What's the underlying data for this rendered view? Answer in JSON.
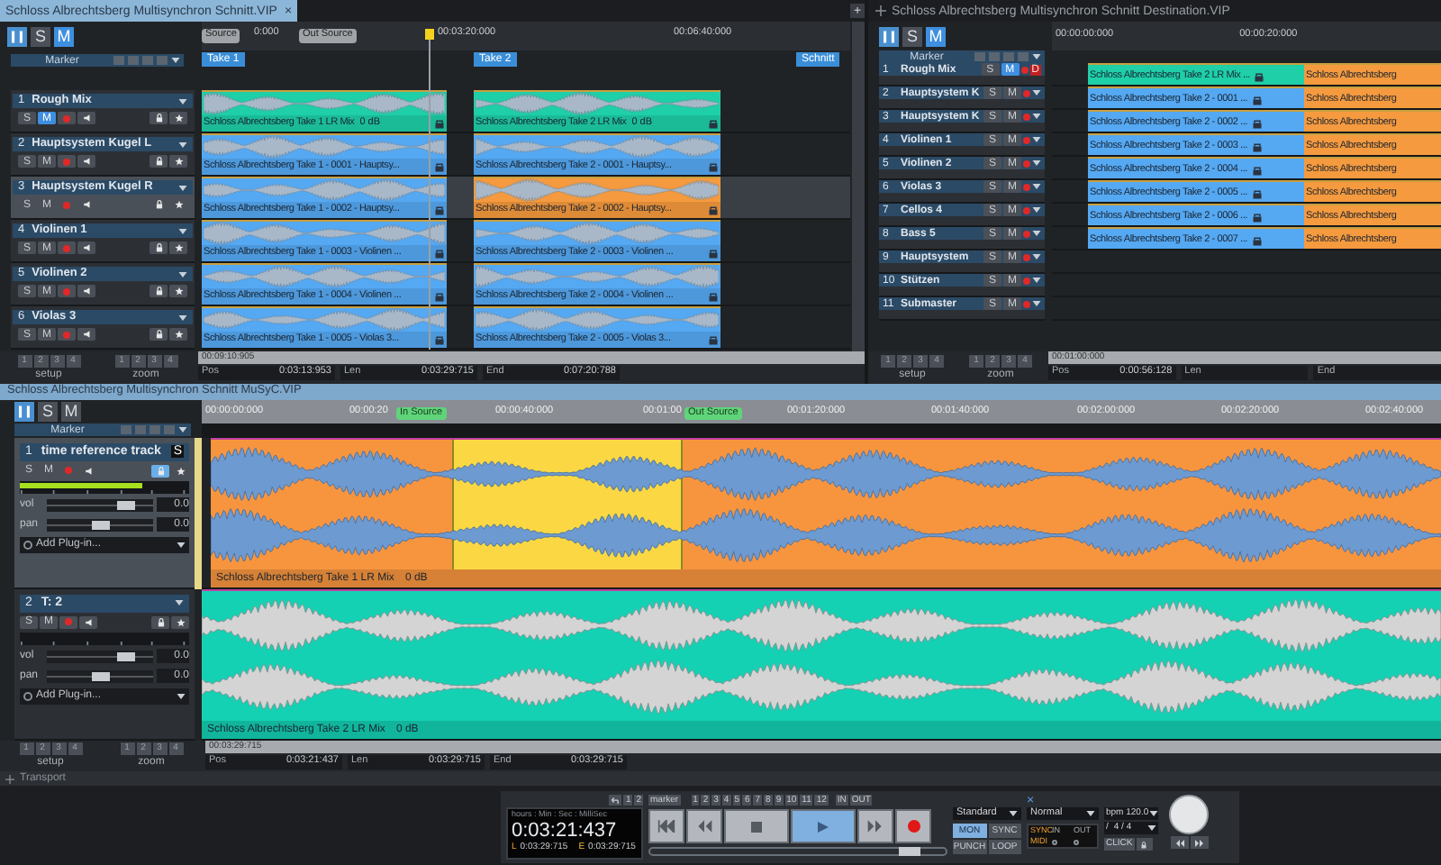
{
  "top_left": {
    "title": "Schloss Albrechtsberg Multisynchron Schnitt.VIP",
    "close": "×",
    "add_tab": "+",
    "modes": [
      {
        "label": "S",
        "selected": false
      },
      {
        "label": "M",
        "selected": true
      }
    ],
    "ruler": [
      {
        "kind": "flag",
        "label": "Source",
        "color": "#a0a4a8"
      },
      {
        "kind": "time",
        "label": "0:000"
      },
      {
        "kind": "flag",
        "label": "Out Source",
        "color": "#a0a4a8"
      },
      {
        "kind": "playhead",
        "label": "00:03:20:000"
      },
      {
        "kind": "time",
        "label": "00:06:40:000"
      }
    ],
    "ranges": [
      "Take 1",
      "Take 2",
      "Schnitt"
    ],
    "marker": "Marker",
    "tracks": [
      {
        "number": "1",
        "name": "Rough Mix",
        "selected": false,
        "solo": {
          "label": "S",
          "on": false
        },
        "mute": {
          "label": "M",
          "on": true
        },
        "clips": [
          {
            "label": "Schloss Albrechtsberg Take 1 LR Mix",
            "gain": "0 dB",
            "color": "#1ecfa8"
          },
          {
            "label": "Schloss Albrechtsberg Take 2 LR Mix",
            "gain": "0 dB",
            "color": "#1ecfa8"
          }
        ]
      },
      {
        "number": "2",
        "name": "Hauptsystem Kugel L",
        "selected": false,
        "solo": {
          "label": "S",
          "on": false
        },
        "mute": {
          "label": "M",
          "on": false
        },
        "clips": [
          {
            "label": "Schloss Albrechtsberg Take 1 - 0001 - Hauptsy...",
            "color": "#55a8f2"
          },
          {
            "label": "Schloss Albrechtsberg Take 2 - 0001 - Hauptsy...",
            "color": "#55a8f2"
          }
        ]
      },
      {
        "number": "3",
        "name": "Hauptsystem Kugel R",
        "selected": true,
        "solo": {
          "label": "S",
          "on": false
        },
        "mute": {
          "label": "M",
          "on": false
        },
        "clips": [
          {
            "label": "Schloss Albrechtsberg Take 1 - 0002 - Hauptsy...",
            "color": "#55a8f2"
          },
          {
            "label": "Schloss Albrechtsberg Take 2 - 0002 - Hauptsy...",
            "color": "#f59a3e"
          }
        ]
      },
      {
        "number": "4",
        "name": "Violinen 1",
        "selected": false,
        "solo": {
          "label": "S",
          "on": false
        },
        "mute": {
          "label": "M",
          "on": false
        },
        "clips": [
          {
            "label": "Schloss Albrechtsberg Take 1 - 0003 - Violinen ...",
            "color": "#55a8f2"
          },
          {
            "label": "Schloss Albrechtsberg Take 2 - 0003 - Violinen ...",
            "color": "#55a8f2"
          }
        ]
      },
      {
        "number": "5",
        "name": "Violinen 2",
        "selected": false,
        "solo": {
          "label": "S",
          "on": false
        },
        "mute": {
          "label": "M",
          "on": false
        },
        "clips": [
          {
            "label": "Schloss Albrechtsberg Take 1 - 0004 - Violinen ...",
            "color": "#55a8f2"
          },
          {
            "label": "Schloss Albrechtsberg Take 2 - 0004 - Violinen ...",
            "color": "#55a8f2"
          }
        ]
      },
      {
        "number": "6",
        "name": "Violas 3",
        "selected": false,
        "solo": {
          "label": "S",
          "on": false
        },
        "mute": {
          "label": "M",
          "on": false
        },
        "clips": [
          {
            "label": "Schloss Albrechtsberg Take 1 - 0005 - Violas 3...",
            "color": "#55a8f2"
          },
          {
            "label": "Schloss Albrechtsberg Take 2 - 0005 - Violas 3...",
            "color": "#55a8f2"
          }
        ]
      }
    ],
    "scroll_time": "00:09:10:905",
    "pos": [
      {
        "label": "Pos",
        "value": "0:03:13:953"
      },
      {
        "label": "Len",
        "value": "0:03:29:715"
      },
      {
        "label": "End",
        "value": "0:07:20:788"
      }
    ],
    "setup": {
      "buttons": [
        "1",
        "2",
        "3",
        "4"
      ],
      "label": "setup"
    },
    "zoom": {
      "buttons": [
        "1",
        "2",
        "3",
        "4"
      ],
      "label": "zoom"
    }
  },
  "top_right": {
    "title": "Schloss Albrechtsberg Multisynchron Schnitt Destination.VIP",
    "modes": [
      {
        "label": "S",
        "selected": false
      },
      {
        "label": "M",
        "selected": true
      }
    ],
    "ruler": [
      "00:00:00:000",
      "00:00:20:000"
    ],
    "marker": "Marker",
    "tracks": [
      {
        "number": "1",
        "name": "Rough Mix",
        "badge": "D",
        "solo": {
          "label": "S",
          "on": false
        },
        "mute": {
          "label": "M",
          "on": true
        },
        "clips": [
          {
            "label": "Schloss Albrechtsberg Take 2 LR Mix ...",
            "color": "#1ecfa8"
          },
          {
            "label": "Schloss Albrechtsberg",
            "color": "#f59a3e"
          }
        ]
      },
      {
        "number": "2",
        "name": "Hauptsystem K",
        "solo": {
          "label": "S",
          "on": false
        },
        "mute": {
          "label": "M",
          "on": false
        },
        "clips": [
          {
            "label": "Schloss Albrechtsberg Take 2 - 0001 ...",
            "color": "#55a8f2"
          },
          {
            "label": "Schloss Albrechtsberg",
            "color": "#f59a3e"
          }
        ]
      },
      {
        "number": "3",
        "name": "Hauptsystem K",
        "solo": {
          "label": "S",
          "on": false
        },
        "mute": {
          "label": "M",
          "on": false
        },
        "clips": [
          {
            "label": "Schloss Albrechtsberg Take 2 - 0002 ...",
            "color": "#55a8f2"
          },
          {
            "label": "Schloss Albrechtsberg",
            "color": "#f59a3e"
          }
        ]
      },
      {
        "number": "4",
        "name": "Violinen 1",
        "solo": {
          "label": "S",
          "on": false
        },
        "mute": {
          "label": "M",
          "on": false
        },
        "clips": [
          {
            "label": "Schloss Albrechtsberg Take 2 - 0003 ...",
            "color": "#55a8f2"
          },
          {
            "label": "Schloss Albrechtsberg",
            "color": "#f59a3e"
          }
        ]
      },
      {
        "number": "5",
        "name": "Violinen 2",
        "solo": {
          "label": "S",
          "on": false
        },
        "mute": {
          "label": "M",
          "on": false
        },
        "clips": [
          {
            "label": "Schloss Albrechtsberg Take 2 - 0004 ...",
            "color": "#55a8f2"
          },
          {
            "label": "Schloss Albrechtsberg",
            "color": "#f59a3e"
          }
        ]
      },
      {
        "number": "6",
        "name": "Violas 3",
        "solo": {
          "label": "S",
          "on": false
        },
        "mute": {
          "label": "M",
          "on": false
        },
        "clips": [
          {
            "label": "Schloss Albrechtsberg Take 2 - 0005 ...",
            "color": "#55a8f2"
          },
          {
            "label": "Schloss Albrechtsberg",
            "color": "#f59a3e"
          }
        ]
      },
      {
        "number": "7",
        "name": "Cellos 4",
        "solo": {
          "label": "S",
          "on": false
        },
        "mute": {
          "label": "M",
          "on": false
        },
        "clips": [
          {
            "label": "Schloss Albrechtsberg Take 2 - 0006 ...",
            "color": "#55a8f2"
          },
          {
            "label": "Schloss Albrechtsberg",
            "color": "#f59a3e"
          }
        ]
      },
      {
        "number": "8",
        "name": "Bass 5",
        "solo": {
          "label": "S",
          "on": false
        },
        "mute": {
          "label": "M",
          "on": false
        },
        "clips": [
          {
            "label": "Schloss Albrechtsberg Take 2 - 0007 ...",
            "color": "#55a8f2"
          },
          {
            "label": "Schloss Albrechtsberg",
            "color": "#f59a3e"
          }
        ]
      },
      {
        "number": "9",
        "name": "Hauptsystem",
        "solo": {
          "label": "S",
          "on": false
        },
        "mute": {
          "label": "M",
          "on": false
        }
      },
      {
        "number": "10",
        "name": "Stützen",
        "solo": {
          "label": "S",
          "on": false
        },
        "mute": {
          "label": "M",
          "on": false
        }
      },
      {
        "number": "11",
        "name": "Submaster",
        "solo": {
          "label": "S",
          "on": false
        },
        "mute": {
          "label": "M",
          "on": false
        }
      }
    ],
    "scroll_time": "00:01:00:000",
    "pos": [
      {
        "label": "Pos",
        "value": "0:00:56:128"
      },
      {
        "label": "Len"
      },
      {
        "label": "End"
      }
    ],
    "setup": {
      "buttons": [
        "1",
        "2",
        "3",
        "4"
      ],
      "label": "setup"
    },
    "zoom": {
      "buttons": [
        "1",
        "2",
        "3",
        "4"
      ],
      "label": "zoom"
    }
  },
  "bottom": {
    "title": "Schloss Albrechtsberg Multisynchron Schnitt MuSyC.VIP",
    "modes": [
      {
        "label": "S",
        "selected": false
      },
      {
        "label": "M",
        "selected": false
      }
    ],
    "ruler": [
      {
        "kind": "time",
        "label": "00:00:00:000"
      },
      {
        "kind": "time",
        "label": "00:00:20"
      },
      {
        "kind": "flag",
        "label": "In Source",
        "color": "#5fd47a"
      },
      {
        "kind": "time",
        "label": "00:00:40:000"
      },
      {
        "kind": "time",
        "label": "00:01:00"
      },
      {
        "kind": "flag",
        "label": "Out Source",
        "color": "#5fd47a"
      },
      {
        "kind": "time",
        "label": "00:01:20:000"
      },
      {
        "kind": "time",
        "label": "00:01:40:000"
      },
      {
        "kind": "time",
        "label": "00:02:00:000"
      },
      {
        "kind": "time",
        "label": "00:02:20:000"
      },
      {
        "kind": "time",
        "label": "00:02:40:000"
      }
    ],
    "marker": "Marker",
    "tracks": [
      {
        "number": "1",
        "name": "time reference track",
        "badge": "S",
        "selected": true,
        "locked": true,
        "solo": {
          "label": "S",
          "on": false
        },
        "mute": {
          "label": "M",
          "on": false
        },
        "meter": {
          "level": 0.72
        },
        "vol": {
          "label": "vol",
          "value": "0.0",
          "level": 0.75
        },
        "pan": {
          "label": "pan",
          "value": "0.0",
          "level": 0.5
        },
        "plugin": "Add Plug-in...",
        "clip": {
          "label": "Schloss Albrechtsberg Take 1 LR Mix",
          "gain": "0 dB",
          "color": "#f7953f"
        }
      },
      {
        "number": "2",
        "name": "T: 2",
        "selected": false,
        "locked": false,
        "solo": {
          "label": "S",
          "on": false
        },
        "mute": {
          "label": "M",
          "on": false
        },
        "vol": {
          "label": "vol",
          "value": "0.0",
          "level": 0.75
        },
        "pan": {
          "label": "pan",
          "value": "0.0",
          "level": 0.5
        },
        "plugin": "Add Plug-in...",
        "clip": {
          "label": "Schloss Albrechtsberg Take 2 LR Mix",
          "gain": "0 dB",
          "color": "#14d1b4"
        }
      }
    ],
    "scroll_time": "00:03:29:715",
    "pos": [
      {
        "label": "Pos",
        "value": "0:03:21:437"
      },
      {
        "label": "Len",
        "value": "0:03:29:715"
      },
      {
        "label": "End",
        "value": "0:03:29:715"
      }
    ],
    "setup": {
      "buttons": [
        "1",
        "2",
        "3",
        "4"
      ],
      "label": "setup"
    },
    "zoom": {
      "buttons": [
        "1",
        "2",
        "3",
        "4"
      ],
      "label": "zoom"
    }
  },
  "transport": {
    "title": "Transport",
    "undo_buttons": [
      "1",
      "2"
    ],
    "display": {
      "header": "hours : Min : Sec : MilliSec",
      "time": "0:03:21:437",
      "l_label": "L",
      "l_value": "0:03:29:715",
      "e_label": "E",
      "e_value": "0:03:29:715"
    },
    "marker_label": "marker",
    "markers": [
      "1",
      "2",
      "3",
      "4",
      "5",
      "6",
      "7",
      "8",
      "9",
      "10",
      "11",
      "12"
    ],
    "in": "IN",
    "out": "OUT",
    "controls": [
      {
        "kind": "start",
        "selected": false
      },
      {
        "kind": "rewind",
        "selected": false
      },
      {
        "kind": "stop",
        "selected": false
      },
      {
        "kind": "play",
        "selected": true
      },
      {
        "kind": "forward",
        "selected": false
      },
      {
        "kind": "record",
        "selected": false
      }
    ],
    "position": {
      "level": 0.88
    },
    "mode": "Standard",
    "toggles": [
      {
        "label": "MON",
        "selected": true
      },
      {
        "label": "SYNC",
        "selected": false
      },
      {
        "label": "PUNCH",
        "selected": false
      },
      {
        "label": "LOOP",
        "selected": false
      }
    ],
    "close": "×",
    "speed": "Normal",
    "sync_label": "SYNC",
    "midi_label": "MIDI",
    "in_label": "IN",
    "out_label": "OUT",
    "bpm": "bpm 120.0",
    "sig_prefix": "/",
    "signature": "4 / 4",
    "click": "CLICK"
  }
}
